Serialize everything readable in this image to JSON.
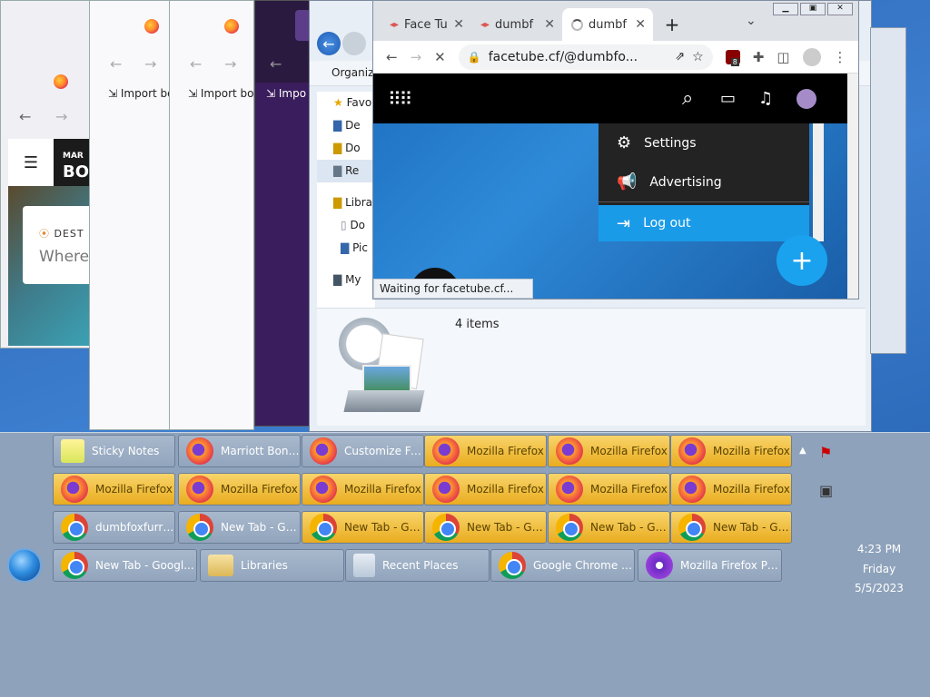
{
  "firefox_windows": {
    "import_label": "Import bo",
    "import_label_short": "Impo",
    "marriott": {
      "brand_top": "MAR",
      "brand_bottom": "BON",
      "search_label": "DEST",
      "search_prompt": "Where"
    }
  },
  "explorer": {
    "toolbar_organize": "Organize",
    "nav": {
      "favorites": "Favo",
      "desktop": "De",
      "downloads": "Do",
      "recent": "Re",
      "libraries": "Libra",
      "documents": "Do",
      "pictures": "Pic",
      "computer": "My"
    },
    "item_count": "4 items"
  },
  "chrome": {
    "tabs": [
      {
        "label": "Face Tu"
      },
      {
        "label": "dumbf"
      },
      {
        "label": "dumbf"
      }
    ],
    "new_tab_glyph": "+",
    "url": "facetube.cf/@dumbfo...",
    "ublock_badge": "8",
    "status_text": "Waiting for facetube.cf...",
    "menu": {
      "settings": "Settings",
      "advertising": "Advertising",
      "logout": "Log out"
    },
    "fab_glyph": "+"
  },
  "taskbar": {
    "row1": [
      {
        "label": "Sticky Notes",
        "icon": "sticky-notes-icon"
      },
      {
        "label": "Marriott Bonv...",
        "icon": "firefox-icon"
      },
      {
        "label": "Customize Fir...",
        "icon": "firefox-icon"
      },
      {
        "label": "Mozilla Firefox",
        "icon": "firefox-icon"
      },
      {
        "label": "Mozilla Firefox",
        "icon": "firefox-icon"
      },
      {
        "label": "Mozilla Firefox",
        "icon": "firefox-icon"
      }
    ],
    "row2": [
      {
        "label": "Mozilla Firefox"
      },
      {
        "label": "Mozilla Firefox"
      },
      {
        "label": "Mozilla Firefox"
      },
      {
        "label": "Mozilla Firefox"
      },
      {
        "label": "Mozilla Firefox"
      },
      {
        "label": "Mozilla Firefox"
      }
    ],
    "row3": [
      {
        "label": "dumbfoxfurry..."
      },
      {
        "label": "New Tab - Go..."
      },
      {
        "label": "New Tab - Go..."
      },
      {
        "label": "New Tab - Go..."
      },
      {
        "label": "New Tab - Go..."
      },
      {
        "label": "New Tab - Go..."
      }
    ],
    "row4": [
      {
        "label": "New Tab - Googl..."
      },
      {
        "label": "Libraries"
      },
      {
        "label": "Recent Places"
      },
      {
        "label": "Google Chrome P..."
      },
      {
        "label": "Mozilla Firefox Pri..."
      }
    ],
    "clock": {
      "time": "4:23 PM",
      "day": "Friday",
      "date": "5/5/2023"
    }
  }
}
